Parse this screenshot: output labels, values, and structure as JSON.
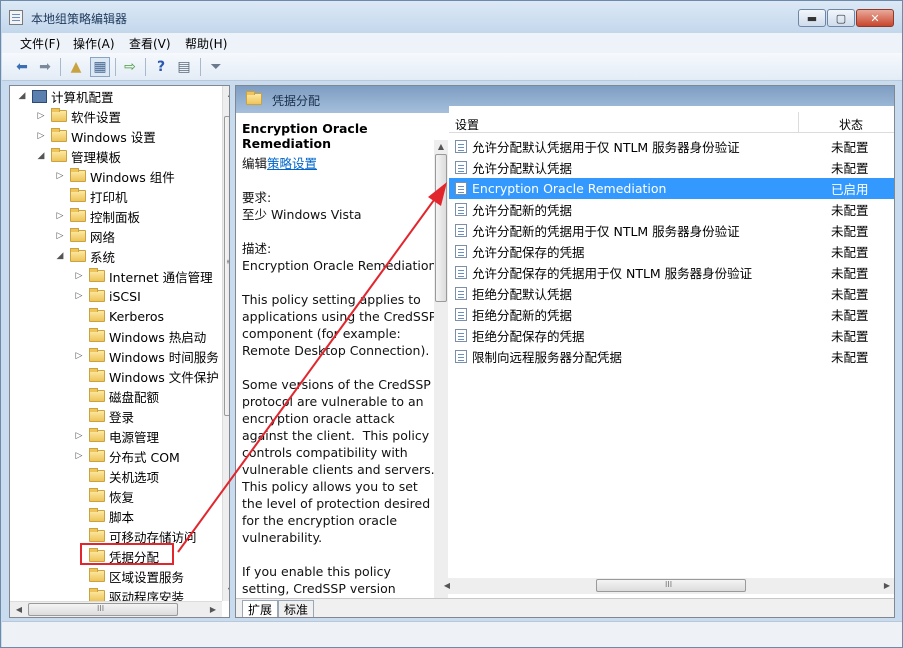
{
  "window": {
    "title": "本地组策略编辑器",
    "min_glyph": "▬",
    "max_glyph": "▢",
    "close_glyph": "✕"
  },
  "menu": {
    "items": [
      "文件(F)",
      "操作(A)",
      "查看(V)",
      "帮助(H)"
    ]
  },
  "toolbar": {
    "icons": [
      "back-arrow-icon",
      "forward-arrow-icon",
      "up-folder-icon",
      "show-hide-tree-icon",
      "export-list-icon",
      "help-icon",
      "properties-icon",
      "filter-icon"
    ]
  },
  "tree": {
    "nodes": [
      {
        "label": "计算机配置",
        "expander": "◢",
        "icon": "computer"
      },
      {
        "label": "软件设置",
        "expander": "▷",
        "icon": "folder"
      },
      {
        "label": "Windows 设置",
        "expander": "▷",
        "icon": "folder"
      },
      {
        "label": "管理模板",
        "expander": "◢",
        "icon": "folder"
      },
      {
        "label": "Windows 组件",
        "expander": "▷",
        "icon": "folder"
      },
      {
        "label": "打印机",
        "expander": "",
        "icon": "folder"
      },
      {
        "label": "控制面板",
        "expander": "▷",
        "icon": "folder"
      },
      {
        "label": "网络",
        "expander": "▷",
        "icon": "folder"
      },
      {
        "label": "系统",
        "expander": "◢",
        "icon": "folder"
      },
      {
        "label": "Internet 通信管理",
        "expander": "▷",
        "icon": "folder"
      },
      {
        "label": "iSCSI",
        "expander": "▷",
        "icon": "folder"
      },
      {
        "label": "Kerberos",
        "expander": "",
        "icon": "folder"
      },
      {
        "label": "Windows 热启动",
        "expander": "",
        "icon": "folder"
      },
      {
        "label": "Windows 时间服务",
        "expander": "▷",
        "icon": "folder"
      },
      {
        "label": "Windows 文件保护",
        "expander": "",
        "icon": "folder"
      },
      {
        "label": "磁盘配额",
        "expander": "",
        "icon": "folder"
      },
      {
        "label": "登录",
        "expander": "",
        "icon": "folder"
      },
      {
        "label": "电源管理",
        "expander": "▷",
        "icon": "folder"
      },
      {
        "label": "分布式 COM",
        "expander": "▷",
        "icon": "folder"
      },
      {
        "label": "关机选项",
        "expander": "",
        "icon": "folder"
      },
      {
        "label": "恢复",
        "expander": "",
        "icon": "folder"
      },
      {
        "label": "脚本",
        "expander": "",
        "icon": "folder"
      },
      {
        "label": "可移动存储访问",
        "expander": "",
        "icon": "folder"
      },
      {
        "label": "凭据分配",
        "expander": "",
        "icon": "folder"
      },
      {
        "label": "区域设置服务",
        "expander": "",
        "icon": "folder"
      },
      {
        "label": "驱动程序安装",
        "expander": "",
        "icon": "folder"
      }
    ],
    "scroll_up": "▲",
    "scroll_down": "▼",
    "scroll_left": "◀",
    "scroll_right": "▶",
    "grip": "≡",
    "hgrip": "III"
  },
  "right": {
    "header": "凭据分配",
    "desc": {
      "title": "Encryption Oracle Remediation",
      "edit_prefix": "编辑",
      "edit_link": "策略设置",
      "lines": [
        "要求:",
        "至少 Windows Vista",
        "",
        "描述:",
        "Encryption Oracle Remediation",
        "",
        "This policy setting applies to",
        "applications using the CredSSP",
        "component (for example:",
        "Remote Desktop Connection).",
        "",
        "Some versions of the CredSSP",
        "protocol are vulnerable to an",
        "encryption oracle attack",
        "against the client.  This policy",
        "controls compatibility with",
        "vulnerable clients and servers.",
        "This policy allows you to set",
        "the level of protection desired",
        "for the encryption oracle",
        "vulnerability.",
        "",
        "If you enable this policy",
        "setting, CredSSP version"
      ]
    },
    "columns": {
      "setting": "设置",
      "state": "状态"
    },
    "rows": [
      {
        "name": "允许分配默认凭据用于仅 NTLM 服务器身份验证",
        "state": "未配置",
        "selected": false
      },
      {
        "name": "允许分配默认凭据",
        "state": "未配置",
        "selected": false
      },
      {
        "name": "Encryption Oracle Remediation",
        "state": "已启用",
        "selected": true
      },
      {
        "name": "允许分配新的凭据",
        "state": "未配置",
        "selected": false
      },
      {
        "name": "允许分配新的凭据用于仅 NTLM 服务器身份验证",
        "state": "未配置",
        "selected": false
      },
      {
        "name": "允许分配保存的凭据",
        "state": "未配置",
        "selected": false
      },
      {
        "name": "允许分配保存的凭据用于仅 NTLM 服务器身份验证",
        "state": "未配置",
        "selected": false
      },
      {
        "name": "拒绝分配默认凭据",
        "state": "未配置",
        "selected": false
      },
      {
        "name": "拒绝分配新的凭据",
        "state": "未配置",
        "selected": false
      },
      {
        "name": "拒绝分配保存的凭据",
        "state": "未配置",
        "selected": false
      },
      {
        "name": "限制向远程服务器分配凭据",
        "state": "未配置",
        "selected": false
      }
    ],
    "tabs": [
      "扩展",
      "标准"
    ]
  },
  "colors": {
    "selection": "#3399ff",
    "annotation": "#e2262d"
  }
}
